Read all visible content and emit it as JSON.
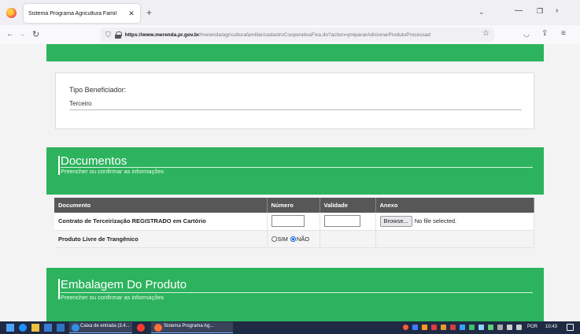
{
  "browser": {
    "tab_title": "Sistema Programa Agricultura Famil",
    "tab_close": "✕",
    "new_tab": "+",
    "url_domain": "https://www.merenda.pr.gov.br",
    "url_path": "/merenda/agriculturafamiliar/cadastroCooperativaFixa.do?action=prepararAdicionarProdutoProcessad"
  },
  "beneficiario": {
    "label": "Tipo Beneficiador:",
    "value": "Terceiro"
  },
  "documentos": {
    "title": "Documentos",
    "subtitle": "Preencher ou confirmar as informações",
    "columns": [
      "Documento",
      "Número",
      "Validade",
      "Anexo"
    ],
    "rows": [
      {
        "documento": "Contrato de Terceirização REGISTRADO em Cartório",
        "browse_label": "Browse...",
        "file_status": "No file selected."
      },
      {
        "documento": "Produto Livre de Trangênico",
        "radio_sim": "SIM",
        "radio_nao": "NÃO",
        "selected": "NÃO"
      }
    ]
  },
  "embalagem": {
    "title": "Embalagem Do Produto",
    "subtitle": "Preencher ou confirmar as informações"
  },
  "taskbar": {
    "mail_label": "Caixa de entrada (3.4...",
    "browser_label": "Sistema Programa Ag...",
    "language": "POR",
    "time": "10:43"
  },
  "colors": {
    "green": "#2db35e",
    "table_header": "#575757"
  }
}
